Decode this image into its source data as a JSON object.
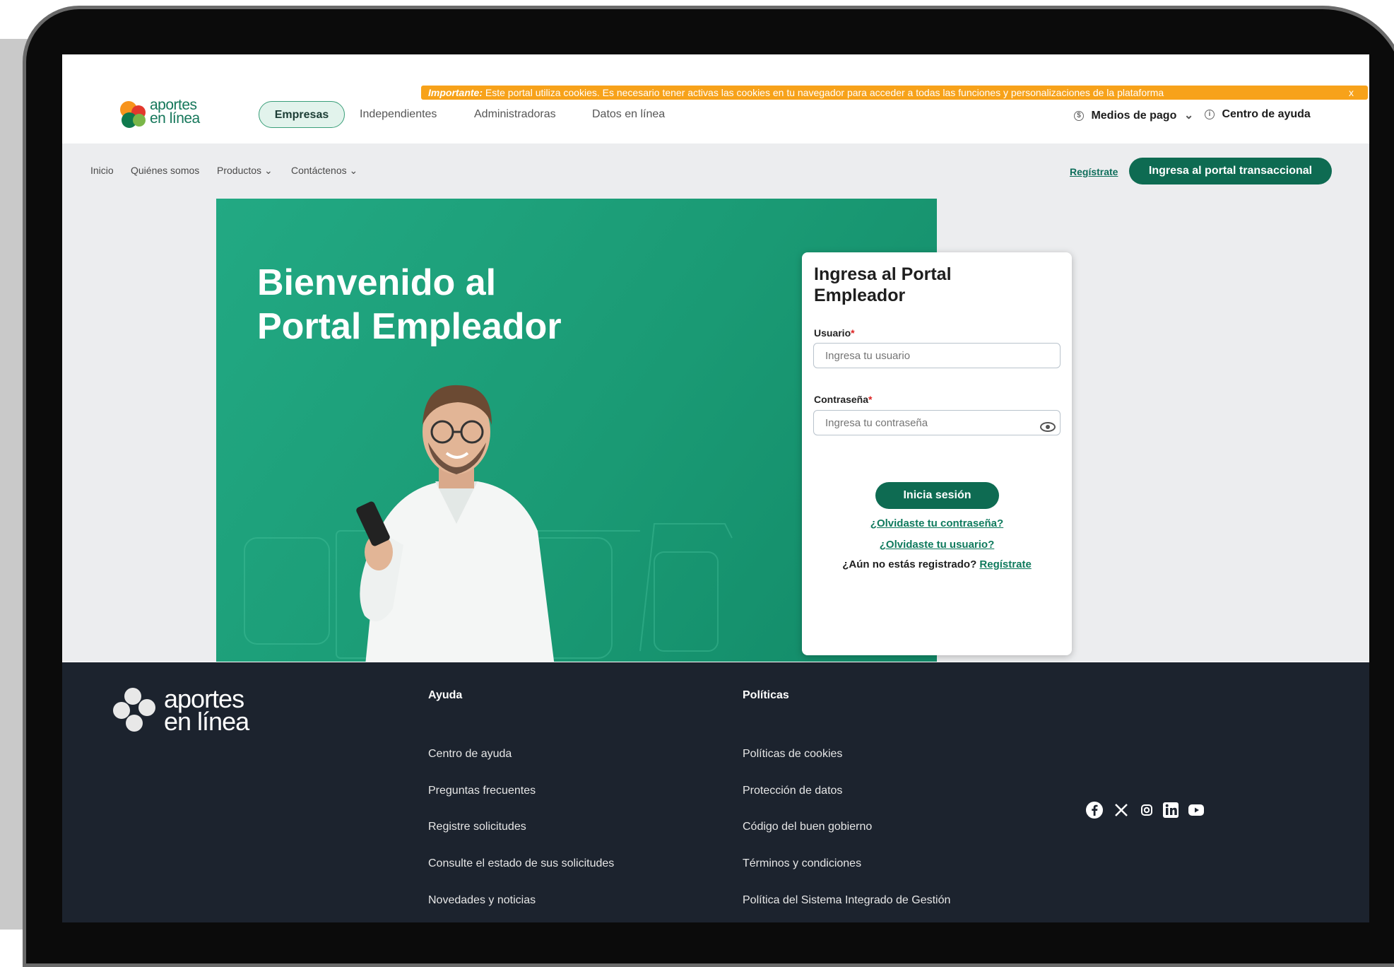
{
  "logo": {
    "line1": "aportes",
    "line2": "en línea"
  },
  "cookie_banner": {
    "label": "Importante:",
    "text": "Este portal utiliza cookies. Es necesario tener activas las cookies en tu navegador para acceder a todas las funciones y personalizaciones de la plataforma",
    "close": "x"
  },
  "tabs": [
    "Empresas",
    "Independientes",
    "Administradoras",
    "Datos en línea"
  ],
  "top_right": {
    "payments": "Medios de pago",
    "help": "Centro de ayuda"
  },
  "subnav": {
    "items": [
      "Inicio",
      "Quiénes somos",
      "Productos",
      "Contáctenos"
    ],
    "register": "Regístrate",
    "portal_button": "Ingresa al portal transaccional"
  },
  "hero": {
    "title_line1": "Bienvenido al",
    "title_line2": "Portal Empleador"
  },
  "login": {
    "title_line1": "Ingresa al Portal",
    "title_line2": "Empleador",
    "user_label": "Usuario",
    "user_placeholder": "Ingresa tu usuario",
    "password_label": "Contraseña",
    "password_placeholder": "Ingresa tu contraseña",
    "required_mark": "*",
    "submit": "Inicia sesión",
    "forgot_password": "¿Olvidaste tu contraseña?",
    "forgot_user": "¿Olvidaste tu usuario?",
    "not_registered": "¿Aún no estás registrado?",
    "register": "Regístrate"
  },
  "footer": {
    "logo_line1": "aportes",
    "logo_line2": "en línea",
    "help_heading": "Ayuda",
    "help_links": [
      "Centro de ayuda",
      "Preguntas frecuentes",
      "Registre solicitudes",
      "Consulte el estado de sus solicitudes",
      "Novedades y noticias"
    ],
    "policies_heading": "Políticas",
    "policy_links": [
      "Políticas de cookies",
      "Protección de datos",
      "Código del buen gobierno",
      "Términos y condiciones",
      "Política del Sistema Integrado de Gestión"
    ],
    "social_icons": [
      "facebook-icon",
      "x-icon",
      "instagram-icon",
      "linkedin-icon",
      "youtube-icon"
    ]
  },
  "colors": {
    "primary": "#0e6b52",
    "hero": "#1a9a74",
    "cookie": "#f7a21a",
    "footer": "#1c232e"
  }
}
